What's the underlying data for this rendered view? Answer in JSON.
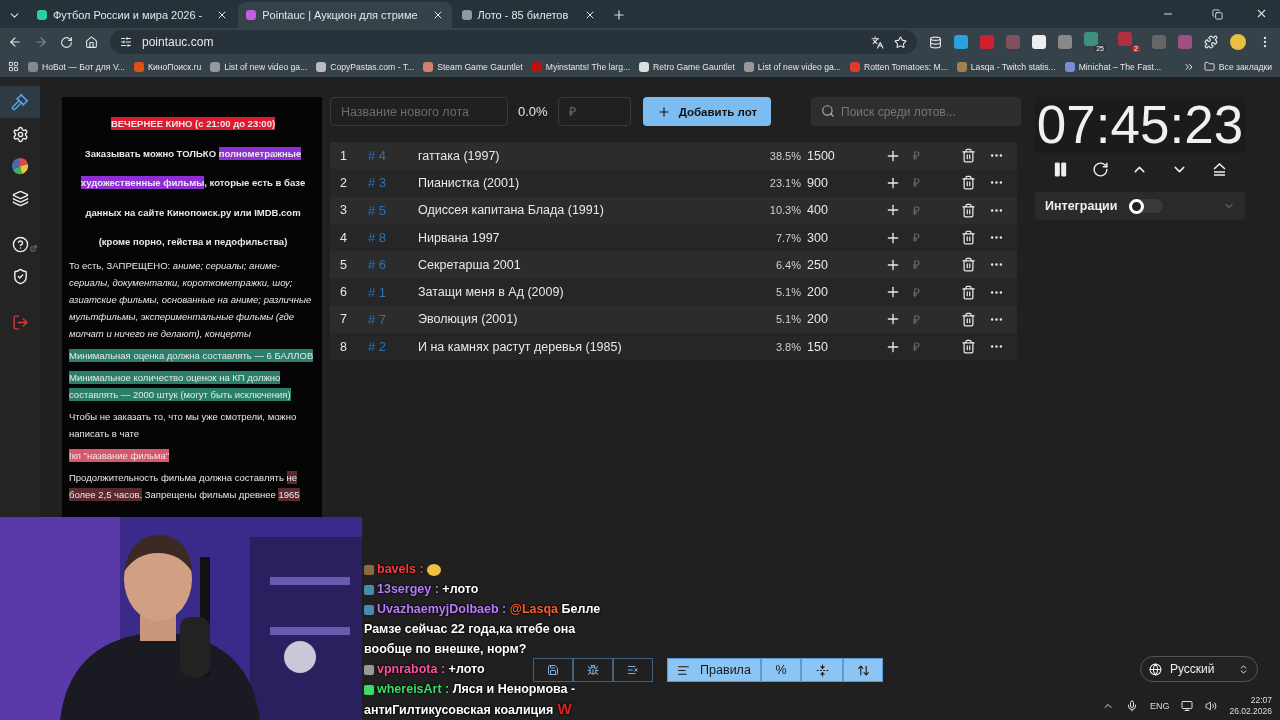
{
  "browser": {
    "tabs": [
      {
        "title": "Футбол России и мира 2026 -",
        "selected": false
      },
      {
        "title": "Pointauc | Аукцион для стриме",
        "selected": true
      },
      {
        "title": "Лото - 85 билетов",
        "selected": false
      }
    ],
    "address": "pointauc.com",
    "bookmarks": [
      "HoBot — Бот для V...",
      "КиноПоиск.ru",
      "List of new video ga...",
      "CopyPastas.com - T...",
      "Steam Game Gauntlet",
      "Myinstants! The larg...",
      "Retro Game Gauntlet",
      "List of new video ga...",
      "Rotten Tomatoes: M...",
      "Lasqa - Twitch statis...",
      "Minichat – The Fast..."
    ],
    "all_bookmarks": "Все закладки",
    "extension_badges": [
      "25",
      "2"
    ]
  },
  "sidebar": {
    "items": [
      {
        "kind": "gavel",
        "selected": true
      },
      {
        "kind": "gear",
        "selected": false
      },
      {
        "kind": "pie",
        "selected": false
      },
      {
        "kind": "layers",
        "selected": false
      },
      {
        "kind": "help",
        "selected": false
      },
      {
        "kind": "shield",
        "selected": false
      },
      {
        "kind": "logout",
        "selected": false
      }
    ]
  },
  "rules": [
    {
      "kind": "heading",
      "segments": [
        {
          "text": "ВЕЧЕРНЕЕ КИНО (с 21:00 до 23:00)",
          "color": "#e0192e"
        }
      ]
    },
    {
      "kind": "heading",
      "segments": [
        {
          "text": "Заказывать можно ТОЛЬКО "
        },
        {
          "text": "полнометражные художественные фильмы",
          "color": "#8e2fd6"
        },
        {
          "text": ", которые есть в базе данных на сайте Кинопоиск.ру или IMDB.com"
        }
      ]
    },
    {
      "kind": "heading",
      "segments": [
        {
          "text": "(кроме порно, гейства и педофильства)"
        }
      ]
    },
    {
      "kind": "text",
      "segments": [
        {
          "text": "То есть, ЗАПРЕЩЕНО: *аниме; сериалы; аниме-сериалы, документалки, короткометражки, шоу; азиатские фильмы, основанные на аниме; различные мультфильмы, экспериментальные фильмы (где молчат и ничего не делают), концерты*"
        }
      ]
    },
    {
      "kind": "text",
      "segments": [
        {
          "text": "Минимальная оценка должна составлять — 6 БАЛЛОВ",
          "color": "#2a7f6a"
        }
      ]
    },
    {
      "kind": "text",
      "segments": [
        {
          "text": "Минимальное количество оценок на КП должно составлять — 2000 штук (могут быть исключения)",
          "color": "#2a7f6a"
        }
      ]
    },
    {
      "kind": "text",
      "segments": [
        {
          "text": "Чтобы не заказать то, что мы уже смотрели, можно написать в чате"
        }
      ]
    },
    {
      "kind": "text",
      "segments": [
        {
          "text": "!кп \"название фильма\"",
          "color": "#d9576a"
        }
      ]
    },
    {
      "kind": "text",
      "segments": [
        {
          "text": "Продолжительность фильма должна составлять "
        },
        {
          "text": "не более 2,5 часов.",
          "color": "#5a2a30"
        },
        {
          "text": " Запрещены фильмы древнее "
        },
        {
          "text": "1965",
          "color": "#5a2a30"
        }
      ]
    }
  ],
  "toolbar": {
    "name_placeholder": "Название нового лота",
    "percent": "0.0%",
    "amount_placeholder": "₽",
    "add_button": "Добавить лот",
    "search_placeholder": "Поиск среди лотов..."
  },
  "lots": [
    {
      "index": "1",
      "id": "# 4",
      "name": "гаттака (1997)",
      "percent": "38.5%",
      "amount": "1500",
      "currency": "₽"
    },
    {
      "index": "2",
      "id": "# 3",
      "name": "Пианистка (2001)",
      "percent": "23.1%",
      "amount": "900",
      "currency": "₽"
    },
    {
      "index": "3",
      "id": "# 5",
      "name": "Одиссея капитана Блада (1991)",
      "percent": "10.3%",
      "amount": "400",
      "currency": "₽"
    },
    {
      "index": "4",
      "id": "# 8",
      "name": "Нирвана 1997",
      "percent": "7.7%",
      "amount": "300",
      "currency": "₽"
    },
    {
      "index": "5",
      "id": "# 6",
      "name": "Секретарша 2001",
      "percent": "6.4%",
      "amount": "250",
      "currency": "₽"
    },
    {
      "index": "6",
      "id": "# 1",
      "name": "Затащи меня в Ад (2009)",
      "percent": "5.1%",
      "amount": "200",
      "currency": "₽"
    },
    {
      "index": "7",
      "id": "# 7",
      "name": "Эволюция (2001)",
      "percent": "5.1%",
      "amount": "200",
      "currency": "₽"
    },
    {
      "index": "8",
      "id": "# 2",
      "name": "И на камнях растут деревья (1985)",
      "percent": "3.8%",
      "amount": "150",
      "currency": "₽"
    }
  ],
  "timer": {
    "time": "07:45:23"
  },
  "integrations": {
    "label": "Интеграции",
    "on": false
  },
  "bottom_toolbar": {
    "rules_button": "Правила",
    "percent_button": "%"
  },
  "language": "Русский",
  "chat": [
    {
      "user": "bavels",
      "separator": ":",
      "color": "#ff3b3b",
      "emote": true
    },
    {
      "user": "13sergey",
      "separator": ":",
      "color": "#b77cff",
      "text": "+лото",
      "emote": false
    },
    {
      "user": "UvazhaemyjDolbaeb",
      "separator": ":",
      "color": "#b77cff",
      "mention": "@Lasqa",
      "text": "Белле Рамзе сейчас 22 года,ка ктебе она вообще по внешке, норм?",
      "emote": false
    },
    {
      "user": "vpnrabota",
      "separator": ":",
      "color": "#ff4fa0",
      "text": "+лото",
      "emote": false
    },
    {
      "user": "whereisArt",
      "separator": ":",
      "color": "#3ddc6a",
      "text": "Ляся и Ненормова - антиГилтикусовская коалиция",
      "emote_text": "W",
      "emote": false
    }
  ],
  "taskbar": {
    "language": "ENG",
    "time": "22:07",
    "date": "26.02.2026"
  }
}
